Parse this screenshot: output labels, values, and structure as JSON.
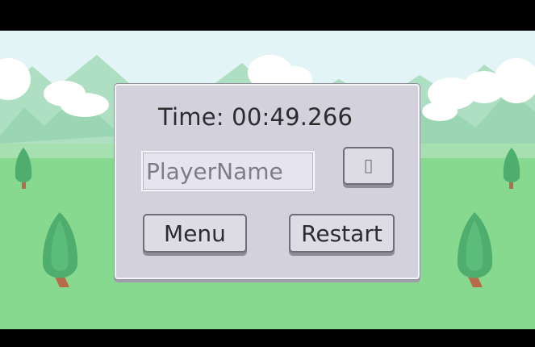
{
  "hud": {
    "time_label": "Time:",
    "time_value": "00:49.266"
  },
  "name_input": {
    "value": "",
    "placeholder": "PlayerName"
  },
  "buttons": {
    "submit_glyph": "▯",
    "menu_label": "Menu",
    "restart_label": "Restart"
  },
  "colors": {
    "sky": "#e3f4f6",
    "grass": "#86d98e",
    "panel": "#d3d2dc"
  }
}
